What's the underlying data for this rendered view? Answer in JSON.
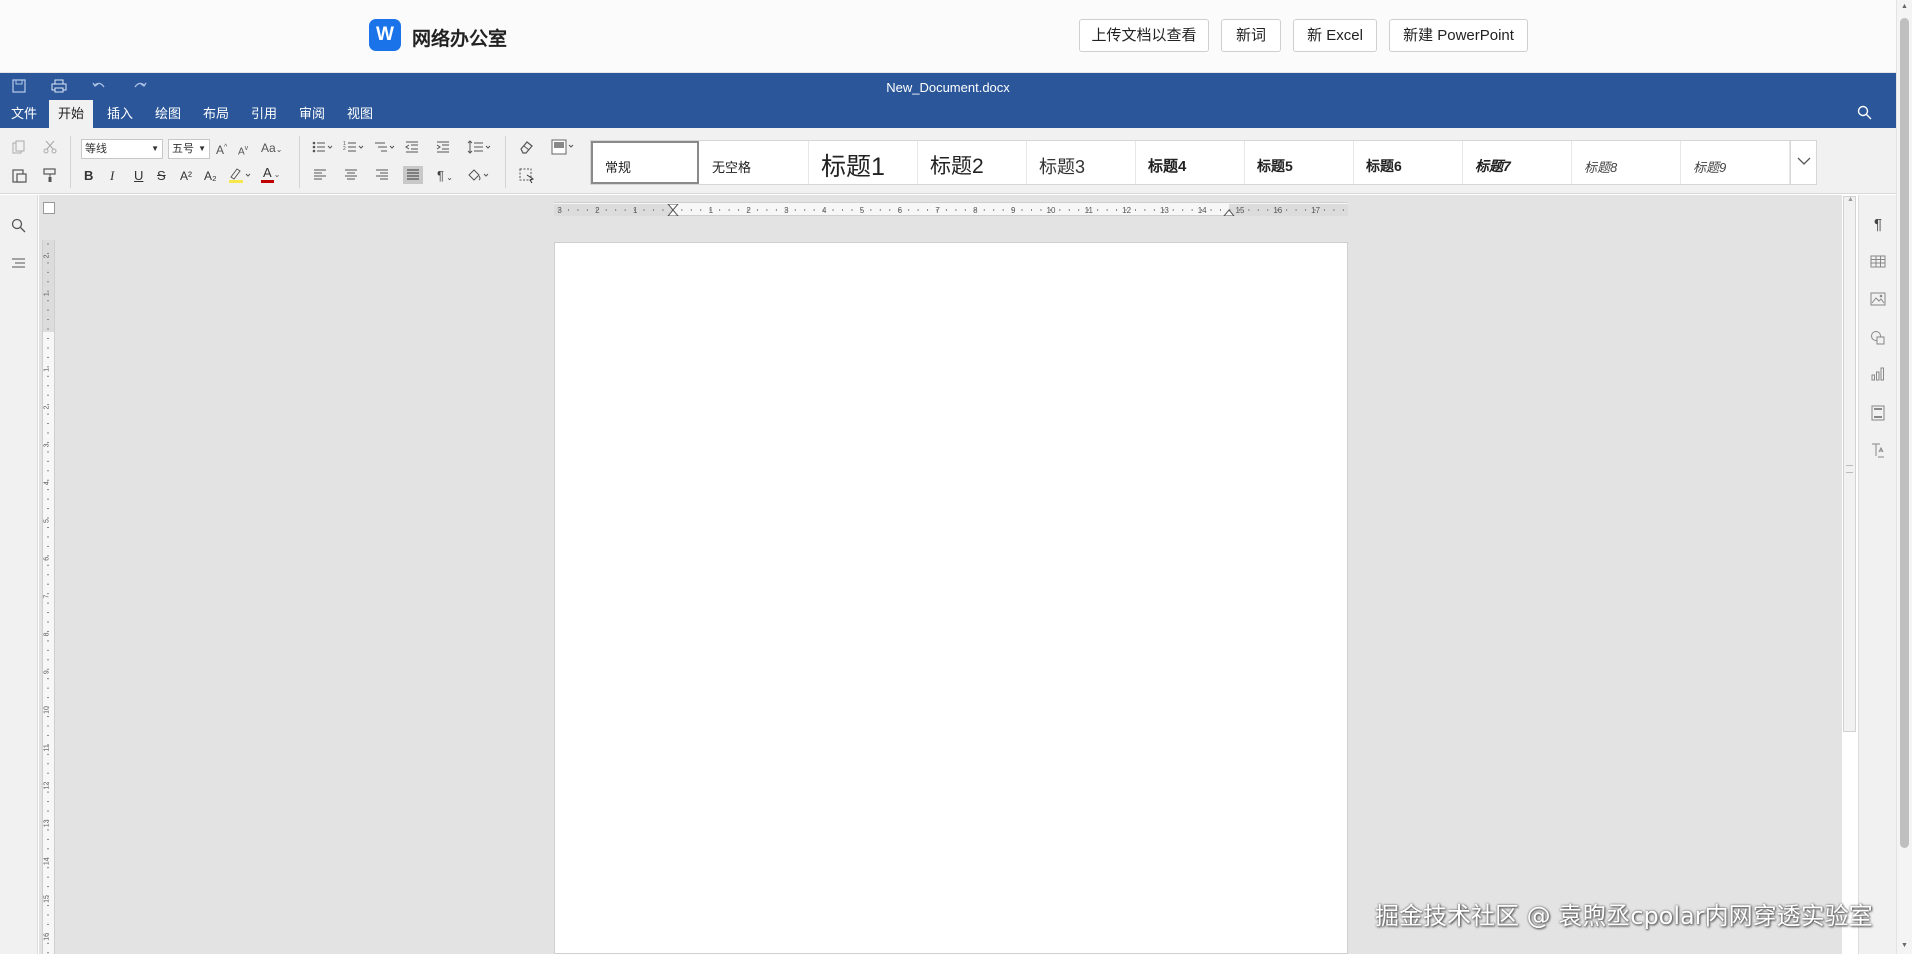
{
  "header": {
    "logo_letter": "W",
    "app_name": "网络办公室",
    "buttons": {
      "upload": "上传文档以查看",
      "new_word": "新词",
      "new_excel": "新 Excel",
      "new_ppt": "新建 PowerPoint"
    }
  },
  "titlebar": {
    "document_title": "New_Document.docx",
    "quick_access": [
      "save-icon",
      "print-icon",
      "undo-icon",
      "redo-icon"
    ]
  },
  "tabs": [
    "文件",
    "开始",
    "插入",
    "绘图",
    "布局",
    "引用",
    "审阅",
    "视图"
  ],
  "active_tab": "开始",
  "ribbon": {
    "font_name": "等线",
    "font_size": "五号",
    "bold": "B",
    "italic": "I",
    "underline": "U",
    "strike": "S",
    "superscript": "A²",
    "subscript": "A₂",
    "font_color_letter": "A",
    "grow_font": "A",
    "shrink_font": "A",
    "change_case": "Aa",
    "pilcrow": "¶",
    "highlight_color": "#f6e84a",
    "font_color": "#c00000"
  },
  "styles": [
    "常规",
    "无空格",
    "标题1",
    "标题2",
    "标题3",
    "标题4",
    "标题5",
    "标题6",
    "标题7",
    "标题8",
    "标题9"
  ],
  "ruler": {
    "horizontal_labels": [
      "3",
      "2",
      "1",
      "1",
      "2",
      "3",
      "4",
      "5",
      "6",
      "7",
      "8",
      "9",
      "10",
      "11",
      "12",
      "13",
      "14",
      "15",
      "16",
      "17"
    ],
    "vertical_labels": [
      "2",
      "1",
      "1",
      "2",
      "3",
      "4",
      "5",
      "6",
      "7",
      "8",
      "9",
      "10",
      "11",
      "12",
      "13",
      "14",
      "15",
      "16"
    ]
  },
  "right_panel": [
    "pilcrow-icon",
    "table-icon",
    "image-icon",
    "shape-icon",
    "chart-icon",
    "header-footer-icon",
    "text-art-icon"
  ],
  "watermark": "掘金技术社区 @ 袁煦丞cpolar内网穿透实验室",
  "colors": {
    "brand_blue": "#2b579a",
    "logo_blue": "#1a73e8"
  }
}
